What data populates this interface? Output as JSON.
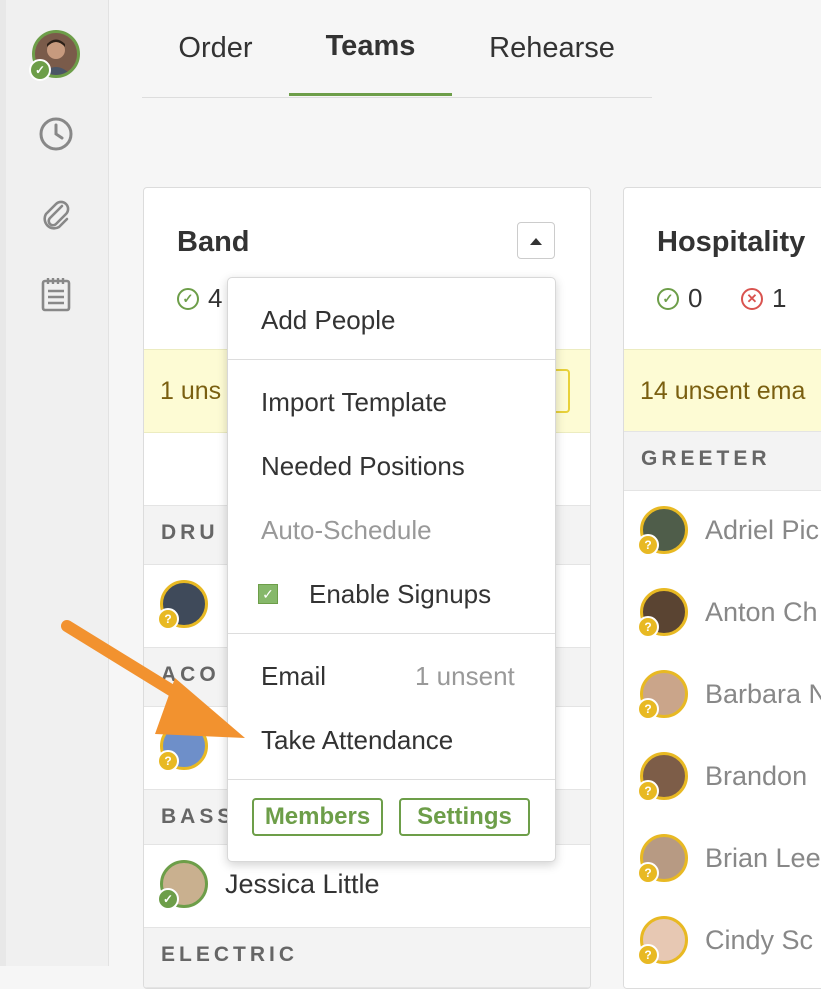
{
  "tabs": [
    {
      "label": "Order"
    },
    {
      "label": "Teams"
    },
    {
      "label": "Rehearse"
    }
  ],
  "band": {
    "title": "Band",
    "confirmed_partial": "4",
    "banner_partial": "1 uns",
    "sections": {
      "drums_partial": "DRU",
      "acoustic_partial": "ACO",
      "bass_partial": "BASS",
      "electric": "ELECTRIC"
    },
    "bass_member": "Jessica Little"
  },
  "hospitality": {
    "title": "Hospitality",
    "confirmed": "0",
    "declined": "1",
    "banner": "14 unsent ema",
    "section": "GREETER",
    "members": [
      "Adriel Pic",
      "Anton Ch",
      "Barbara N",
      "Brandon",
      "Brian Lee",
      "Cindy Sc"
    ]
  },
  "menu": {
    "add_people": "Add People",
    "import_template": "Import Template",
    "needed_positions": "Needed Positions",
    "auto_schedule": "Auto-Schedule",
    "enable_signups": "Enable Signups",
    "email": "Email",
    "email_status": "1 unsent",
    "take_attendance": "Take Attendance",
    "members_button": "Members",
    "settings_button": "Settings"
  },
  "colors": {
    "accent": "#6d9e49",
    "warning": "#e8b923",
    "danger": "#d9534f",
    "arrow": "#f2922f"
  }
}
